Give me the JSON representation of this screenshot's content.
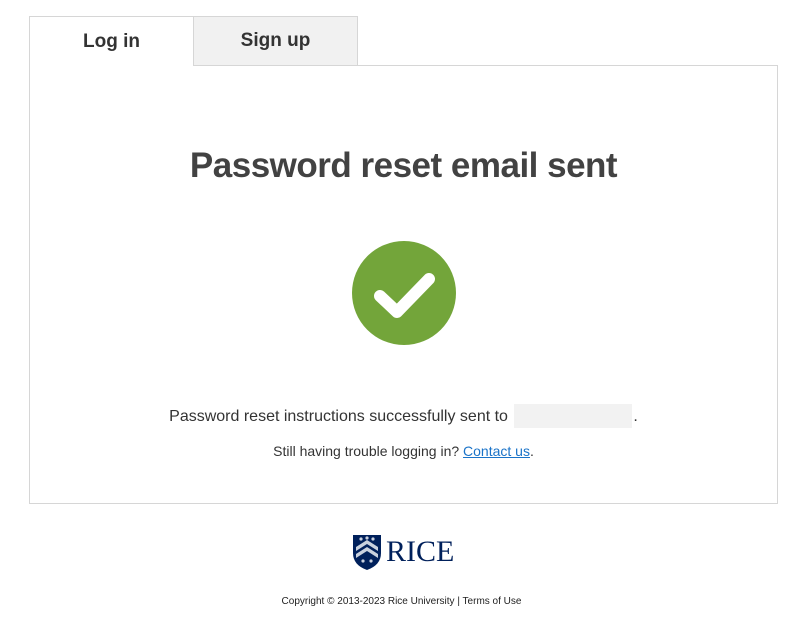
{
  "tabs": {
    "login_label": "Log in",
    "signup_label": "Sign up"
  },
  "main": {
    "title": "Password reset email sent",
    "message_prefix": "Password reset instructions successfully sent to",
    "message_suffix": ".",
    "help_text": "Still having trouble logging in?",
    "contact_link": "Contact us",
    "help_suffix": "."
  },
  "icons": {
    "success": "check-circle-icon",
    "logo": "rice-shield-logo"
  },
  "colors": {
    "success_green": "#73a53a",
    "link_blue": "#1a73c8",
    "brand_navy": "#00205b"
  },
  "footer": {
    "logo_text": "RICE",
    "copyright": "Copyright © 2013-2023 Rice University",
    "separator": "|",
    "terms_link": "Terms of Use"
  }
}
